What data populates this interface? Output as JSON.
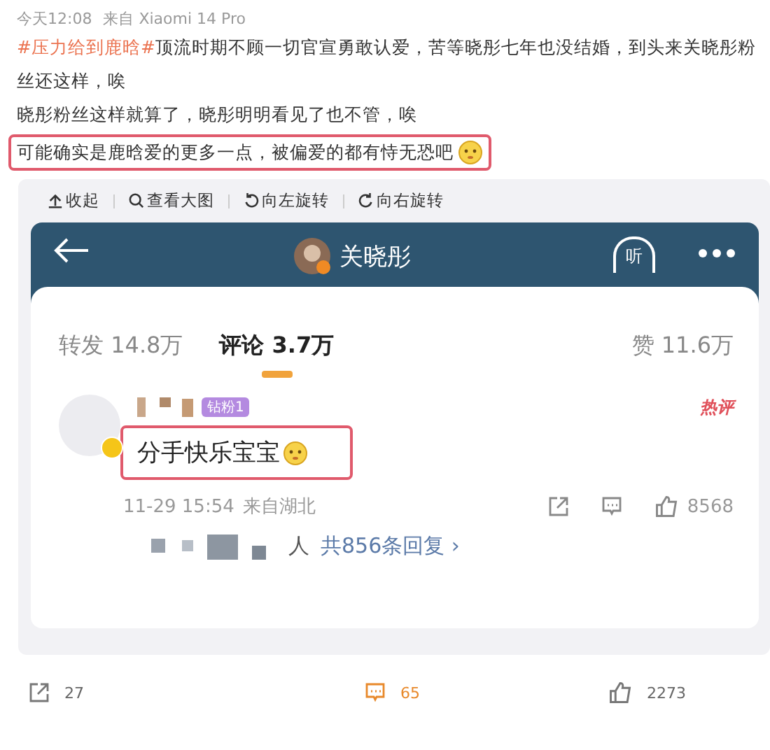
{
  "meta": {
    "time": "今天12:08",
    "source": "来自 Xiaomi 14 Pro"
  },
  "post": {
    "topic": "#压力给到鹿晗#",
    "lines": [
      "顶流时期不顾一切官宣勇敢认爱，苦等晓彤七年也没结婚，到头来关晓彤粉丝还这样，唉",
      "晓彤粉丝这样就算了，晓彤明明看见了也不管，唉"
    ],
    "highlight": "可能确实是鹿晗爱的更多一点，被偏爱的都有恃无恐吧"
  },
  "image_toolbar": [
    {
      "kind": "collapse",
      "label": "收起"
    },
    {
      "kind": "zoom",
      "label": "查看大图"
    },
    {
      "kind": "rotate-left",
      "label": "向左旋转"
    },
    {
      "kind": "rotate-right",
      "label": "向右旋转"
    }
  ],
  "screenshot": {
    "header": {
      "title": "关晓彤",
      "listen": "听"
    },
    "tabs": [
      {
        "label": "转发 14.8万",
        "selected": false
      },
      {
        "label": "评论 3.7万",
        "selected": true
      },
      {
        "label": "赞 11.6万",
        "selected": false
      }
    ],
    "comment": {
      "badge": "钻粉1",
      "hot": "热评",
      "text": "分手快乐宝宝",
      "time": "11-29 15:54",
      "location": "来自湖北",
      "likes": "8568",
      "replies": "人",
      "reply_total": "共856条回复 ›"
    }
  },
  "actions": [
    {
      "kind": "share",
      "count": "27",
      "selected": false
    },
    {
      "kind": "comment",
      "count": "65",
      "selected": true
    },
    {
      "kind": "like",
      "count": "2273",
      "selected": false
    }
  ]
}
